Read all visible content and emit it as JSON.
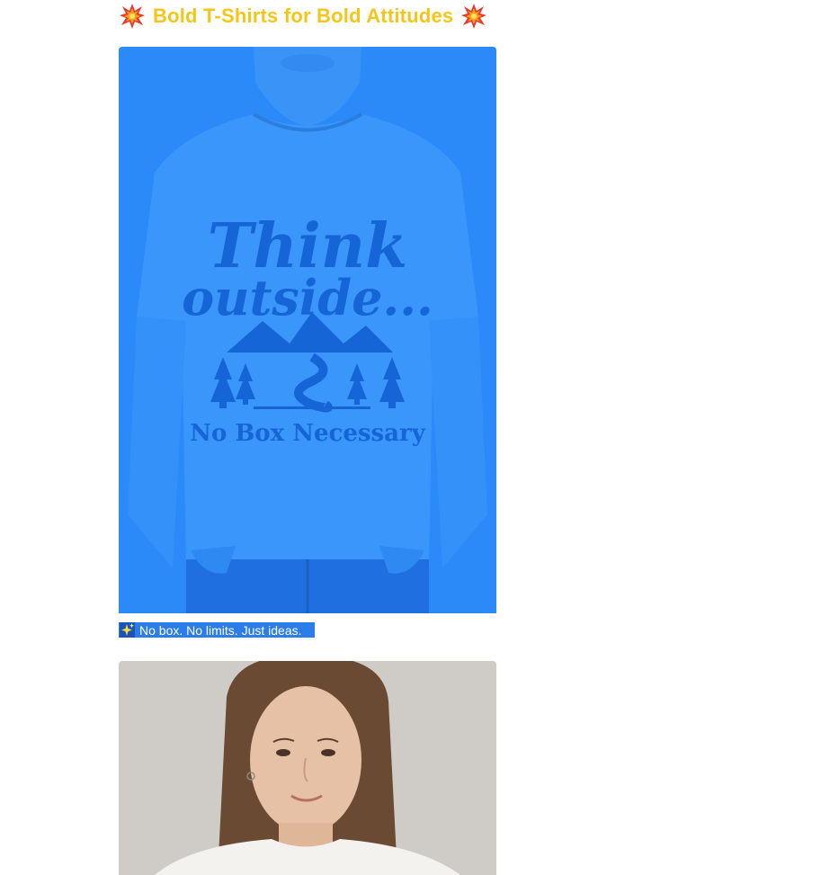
{
  "headline": {
    "title": "Bold T-Shirts for Bold Attitudes",
    "left_icon": "collision-burst-icon",
    "right_icon": "collision-burst-icon",
    "title_color": "#f5c518"
  },
  "product_1": {
    "shirt_print": {
      "line_1": "Think",
      "line_2": "outside...",
      "line_3": "No Box Necessary"
    },
    "overlay_color": "#2b7de9",
    "caption": {
      "icon": "sparkles-icon",
      "text": "No box. No limits. Just ideas."
    }
  },
  "product_2": {
    "background_color": "#cfcbc6"
  }
}
